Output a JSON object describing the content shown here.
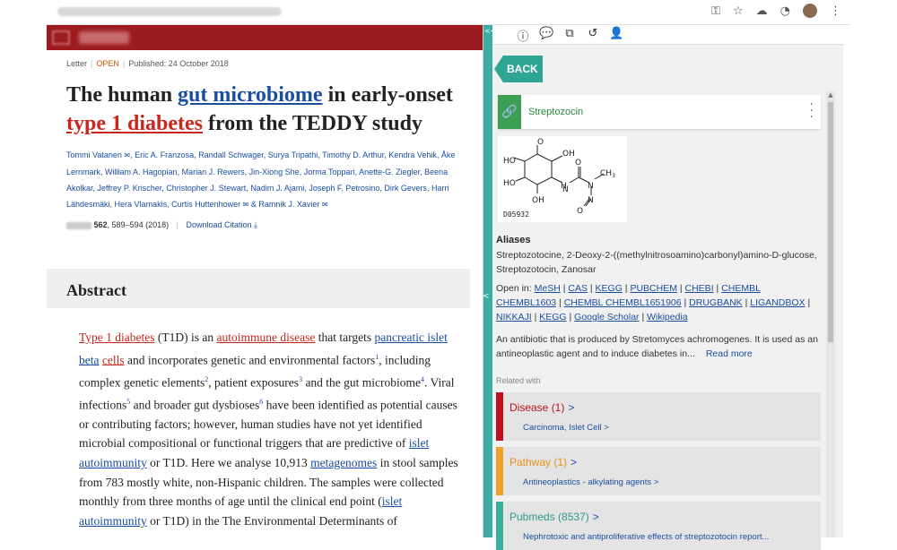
{
  "article": {
    "meta_type": "Letter",
    "meta_access": "OPEN",
    "meta_published": "Published: 24 October 2018",
    "title_1": "The human ",
    "title_link1": "gut microbiome",
    "title_2": " in early-onset",
    "title_link2": "type 1 diabetes",
    "title_3": " from the TEDDY study",
    "authors": [
      "Tommi Vatanen",
      "Eric A. Franzosa",
      "Randall Schwager",
      "Surya Tripathi",
      "Timothy D. Arthur",
      "Kendra Vehik",
      "Åke Lernmark",
      "William A. Hagopian",
      "Marian J. Rewers",
      "Jin-Xiong She",
      "Jorma Toppari",
      "Anette-G. Ziegler",
      "Beena Akolkar",
      "Jeffrey P. Krischer",
      "Christopher J. Stewart",
      "Nadim J. Ajami",
      "Joseph F. Petrosino",
      "Dirk Gevers",
      "Harri Lähdesmäki",
      "Hera Vlamakis",
      "Curtis Huttenhower",
      "Ramnik J. Xavier"
    ],
    "citation_vol": "562",
    "citation_pages": ", 589–594 (2018)",
    "download": "Download Citation",
    "abstract_heading": "Abstract",
    "abstract": {
      "t1": "Type 1 diabetes",
      "t2": " (T1D) is an ",
      "t3": "autoimmune disease",
      "t4": " that targets ",
      "t5": "pancreatic islet",
      "t6": "beta",
      "t7": "cells",
      "t8": " and incorporates genetic and environmental factors",
      "s1": "1",
      "t9": ", including complex genetic elements",
      "s2": "2",
      "t10": ", patient exposures",
      "s3": "3",
      "t11": " and the gut microbiome",
      "s4": "4",
      "t12": ". Viral infections",
      "s5": "5",
      "t13": " and broader gut dysbioses",
      "s6": "6",
      "t14": " have been identified as potential causes or contributing factors; however, human studies have not yet identified microbial compositional or functional triggers that are predictive of ",
      "t15": "islet",
      "t16": "autoimmunity",
      "t17": " or T1D. Here we analyse 10,913 ",
      "t18": "metagenomes",
      "t19": " in stool samples from 783 mostly white, non-Hispanic children. The samples were collected monthly from three months of age until the clinical end point (",
      "t20": "islet",
      "t21": "autoimmunity",
      "t22": " or T1D) in the The Environmental Determinants of"
    }
  },
  "panel": {
    "collapse": "<<",
    "side_arrow": "<",
    "back": "BACK",
    "compound_name": "Streptozocin",
    "structure_code": "D05932",
    "aliases_heading": "Aliases",
    "aliases": "Streptozotocine, 2-Deoxy-2-((methylnitrosoamino)carbonyl)amino-D-glucose, Streptozotocin, Zanosar",
    "open_in_label": "Open in: ",
    "open_in_links": [
      "MeSH",
      "CAS",
      "KEGG",
      "PUBCHEM",
      "CHEBI",
      "CHEMBL CHEMBL1603",
      "CHEMBL CHEMBL1651906",
      "DRUGBANK",
      "LIGANDBOX",
      "NIKKAJI",
      "KEGG",
      "Google Scholar",
      "Wikipedia"
    ],
    "description": "An antibiotic that is produced by Stretomyces achromogenes. It is used as an antineoplastic agent and to induce diabetes in...",
    "read_more": "Read more",
    "related_heading": "Related with",
    "related": [
      {
        "title": "Disease (1)",
        "arrow": ">",
        "sub": "Carcinoma, Islet Cell >",
        "color": "#c0101e",
        "text_color": "#c0101e"
      },
      {
        "title": "Pathway (1)",
        "arrow": ">",
        "sub": "Antineoplastics - alkylating agents >",
        "color": "#f0a02a",
        "text_color": "#e8901a"
      },
      {
        "title": "Pubmeds (8537)",
        "arrow": ">",
        "sub": "Nephrotoxic and antiproliferative effects of streptozotocin report...",
        "color": "#3aaea3",
        "text_color": "#2a9a8e"
      }
    ]
  },
  "colors": {
    "nature_red": "#9b1b1f",
    "teal": "#2fa596",
    "link_blue": "#1a4ea1",
    "link_red": "#c8271d"
  }
}
